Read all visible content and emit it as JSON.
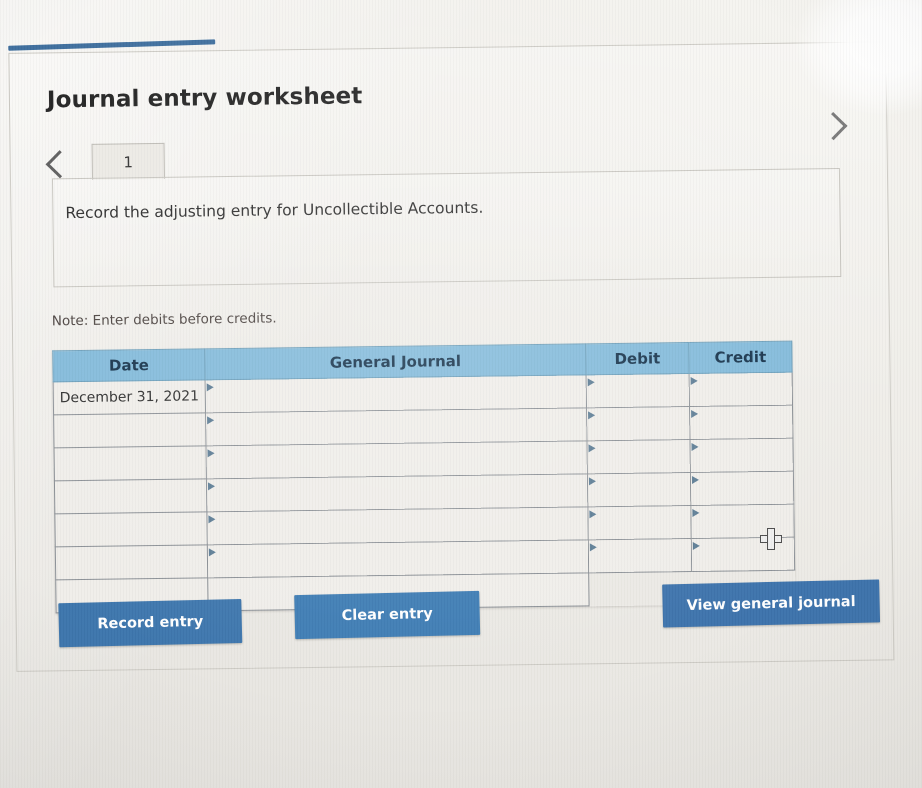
{
  "page": {
    "title": "Journal entry worksheet",
    "note": "Note: Enter debits before credits."
  },
  "pager": {
    "prev_icon": "chevron-left-icon",
    "next_icon": "chevron-right-icon",
    "tabs": [
      "1"
    ],
    "active_tab": "1"
  },
  "description": {
    "text": "Record the adjusting entry for Uncollectible Accounts."
  },
  "journal_table": {
    "columns": [
      "Date",
      "General Journal",
      "Debit",
      "Credit"
    ],
    "rows": [
      {
        "date": "December 31, 2021",
        "general_journal": "",
        "debit": "",
        "credit": ""
      },
      {
        "date": "",
        "general_journal": "",
        "debit": "",
        "credit": ""
      },
      {
        "date": "",
        "general_journal": "",
        "debit": "",
        "credit": ""
      },
      {
        "date": "",
        "general_journal": "",
        "debit": "",
        "credit": ""
      },
      {
        "date": "",
        "general_journal": "",
        "debit": "",
        "credit": ""
      },
      {
        "date": "",
        "general_journal": "",
        "debit": "",
        "credit": ""
      }
    ]
  },
  "buttons": {
    "record": "Record entry",
    "clear": "Clear entry",
    "view": "View general journal"
  },
  "colors": {
    "tab_rule": "#3f6f9e",
    "table_header_bg": "#82bada",
    "table_header_text": "#14314a",
    "button_bg": "#3d76ad",
    "button_text": "#ffffff"
  },
  "cursor": {
    "icon": "crosshair-cursor"
  }
}
